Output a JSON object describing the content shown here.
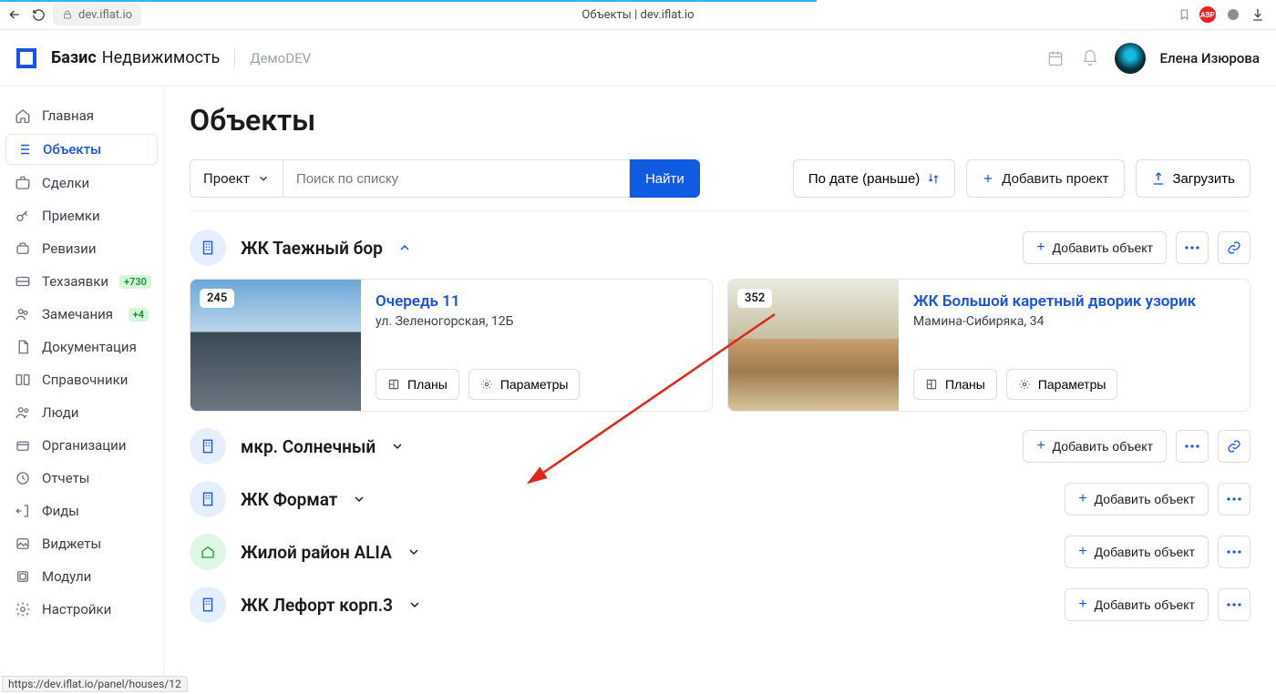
{
  "browser": {
    "url": "dev.iflat.io",
    "tab_title": "Объекты | dev.iflat.io",
    "abp": "ABP"
  },
  "header": {
    "logo_bold": "Базис",
    "logo_thin": "Недвижимость",
    "demo": "ДемоDEV",
    "user": "Елена Изюрова"
  },
  "sidebar": [
    {
      "label": "Главная"
    },
    {
      "label": "Объекты"
    },
    {
      "label": "Сделки"
    },
    {
      "label": "Приемки"
    },
    {
      "label": "Ревизии"
    },
    {
      "label": "Техзаявки",
      "badge": "+730"
    },
    {
      "label": "Замечания",
      "badge": "+4"
    },
    {
      "label": "Документация"
    },
    {
      "label": "Справочники"
    },
    {
      "label": "Люди"
    },
    {
      "label": "Организации"
    },
    {
      "label": "Отчеты"
    },
    {
      "label": "Фиды"
    },
    {
      "label": "Виджеты"
    },
    {
      "label": "Модули"
    },
    {
      "label": "Настройки"
    }
  ],
  "page": {
    "title": "Объекты",
    "filter_label": "Проект",
    "search_placeholder": "Поиск по списку",
    "find": "Найти",
    "sort": "По дате (раньше)",
    "add_project": "Добавить проект",
    "upload": "Загрузить",
    "add_object": "Добавить объект"
  },
  "groups": [
    {
      "name": "ЖК Таежный бор",
      "expanded": true,
      "tone": "blue"
    },
    {
      "name": "мкр. Солнечный",
      "expanded": false,
      "tone": "blue"
    },
    {
      "name": "ЖК Формат",
      "expanded": false,
      "tone": "blue"
    },
    {
      "name": "Жилой район ALIA",
      "expanded": false,
      "tone": "green"
    },
    {
      "name": "ЖК Лефорт корп.3",
      "expanded": false,
      "tone": "blue"
    }
  ],
  "cards": [
    {
      "count": "245",
      "title": "Очередь 11",
      "addr": "ул. Зеленогорская, 12Б"
    },
    {
      "count": "352",
      "title": "ЖК Большой каретный дворик узорик",
      "addr": "Мамина-Сибиряка, 34"
    }
  ],
  "card_btn": {
    "plans": "Планы",
    "params": "Параметры"
  },
  "status_url": "https://dev.iflat.io/panel/houses/12"
}
